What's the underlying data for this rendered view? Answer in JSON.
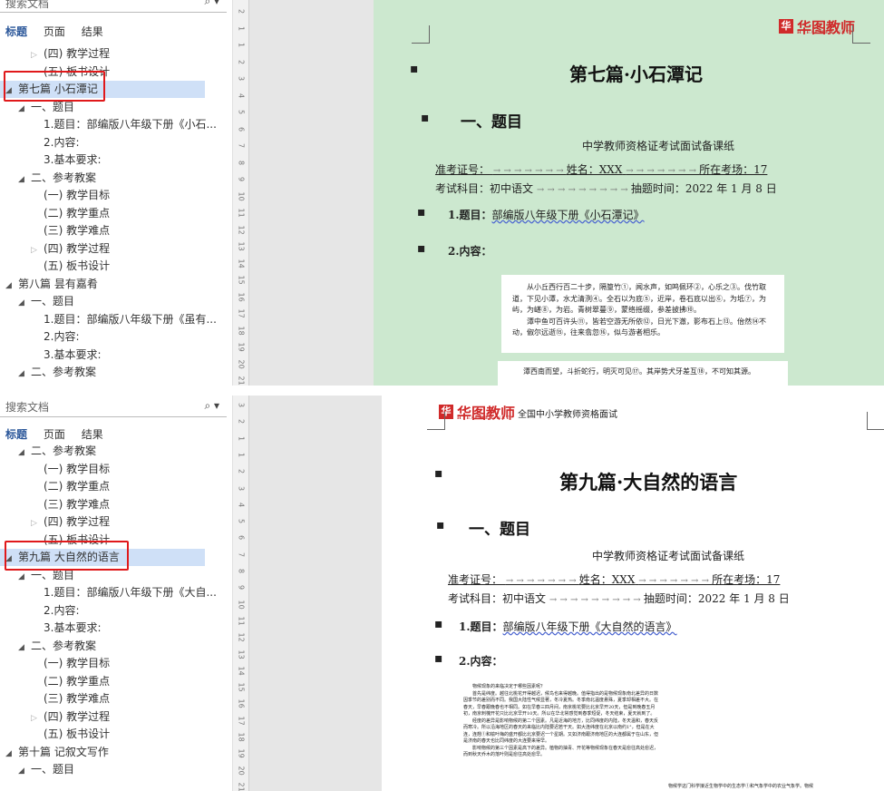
{
  "panel1": {
    "search_placeholder": "搜索文档",
    "tabs": [
      "标题",
      "页面",
      "结果"
    ],
    "tree": [
      {
        "arrow": "▷",
        "label": "(四) 教学过程"
      },
      {
        "arrow": "",
        "label": "(五) 板书设计"
      },
      {
        "arrow": "◢",
        "label": "第七篇 小石潭记"
      },
      {
        "arrow": "◢",
        "label": "一、题目"
      },
      {
        "arrow": "",
        "label": "1.题目：部编版八年级下册《小石..."
      },
      {
        "arrow": "",
        "label": "2.内容:"
      },
      {
        "arrow": "",
        "label": "3.基本要求:"
      },
      {
        "arrow": "◢",
        "label": "二、参考教案"
      },
      {
        "arrow": "",
        "label": "(一) 教学目标"
      },
      {
        "arrow": "",
        "label": "(二) 教学重点"
      },
      {
        "arrow": "",
        "label": "(三) 教学难点"
      },
      {
        "arrow": "▷",
        "label": "(四) 教学过程"
      },
      {
        "arrow": "",
        "label": "(五) 板书设计"
      },
      {
        "arrow": "◢",
        "label": "第八篇 昙有嘉肴"
      },
      {
        "arrow": "◢",
        "label": "一、题目"
      },
      {
        "arrow": "",
        "label": "1.题目：部编版八年级下册《虽有..."
      },
      {
        "arrow": "",
        "label": "2.内容:"
      },
      {
        "arrow": "",
        "label": "3.基本要求:"
      },
      {
        "arrow": "◢",
        "label": "二、参考教案"
      }
    ],
    "ruler": [
      "2",
      "1",
      "1",
      "2",
      "3",
      "4",
      "5",
      "6",
      "7",
      "8",
      "9",
      "10",
      "11",
      "12",
      "13",
      "14",
      "15",
      "16",
      "17",
      "18",
      "19",
      "20",
      "21"
    ],
    "logo_text": "华图教师",
    "logo_sub": "HTEACHER.NET",
    "doc": {
      "title": "第七篇·小石潭记",
      "h1": "一、题目",
      "subtitle": "中学教师资格证考试面试备课纸",
      "exam_no_label": "准考证号：",
      "name_label": "姓名：XXX",
      "room_label": "所在考场：17",
      "subject_label": "考试科目：初中语文",
      "draw_time": "抽题时间：2022 年 1 月 8 日",
      "q1_label": "1.题目：",
      "q1_text": "部编版八年级下册《小石潭记》",
      "q2_label": "2.内容：",
      "passage": [
        "从小丘西行百二十步，隔篁竹①，闻水声，如鸣佩环②，心乐之③。伐竹取道，下见小潭，水尤清洌④。全石以为底⑤，近岸，卷石底以出⑥，为坻⑦，为屿，为嵁⑧，为岩。青树翠蔓⑨，蒙络摇缀，参差披拂⑩。",
        "潭中鱼可百许头⑪，皆若空游无所依⑫，日光下澈，影布石上⑬。佁然⑭不动，俶尔远逝⑮，往来翕忽⑯，似与游者相乐。"
      ],
      "passage2": "潭西南而望，斗折蛇行，明灭可见⑰。其岸势犬牙差互⑱，不可知其源。"
    }
  },
  "panel2": {
    "search_placeholder": "搜索文档",
    "tabs": [
      "标题",
      "页面",
      "结果"
    ],
    "tree": [
      {
        "arrow": "◢",
        "label": "二、参考教案"
      },
      {
        "arrow": "",
        "label": "(一) 教学目标"
      },
      {
        "arrow": "",
        "label": "(二) 教学重点"
      },
      {
        "arrow": "",
        "label": "(三) 教学难点"
      },
      {
        "arrow": "▷",
        "label": "(四) 教学过程"
      },
      {
        "arrow": "",
        "label": "(五) 板书设计"
      },
      {
        "arrow": "◢",
        "label": "第九篇 大自然的语言"
      },
      {
        "arrow": "◢",
        "label": "一、题目"
      },
      {
        "arrow": "",
        "label": "1.题目：部编版八年级下册《大自..."
      },
      {
        "arrow": "",
        "label": "2.内容:"
      },
      {
        "arrow": "",
        "label": "3.基本要求:"
      },
      {
        "arrow": "◢",
        "label": "二、参考教案"
      },
      {
        "arrow": "",
        "label": "(一) 教学目标"
      },
      {
        "arrow": "",
        "label": "(二) 教学重点"
      },
      {
        "arrow": "",
        "label": "(三) 教学难点"
      },
      {
        "arrow": "▷",
        "label": "(四) 教学过程"
      },
      {
        "arrow": "",
        "label": "(五) 板书设计"
      },
      {
        "arrow": "◢",
        "label": "第十篇 记叙文写作"
      },
      {
        "arrow": "◢",
        "label": "一、题目"
      }
    ],
    "ruler": [
      "3",
      "2",
      "1",
      "1",
      "2",
      "3",
      "4",
      "5",
      "6",
      "7",
      "8",
      "9",
      "10",
      "11",
      "12",
      "13",
      "14",
      "15",
      "16",
      "17",
      "18",
      "19",
      "20",
      "21"
    ],
    "logo_text": "华图教师",
    "logo_sub": "HTEACHER.NET",
    "header_text": "全国中小学教师资格面试",
    "doc": {
      "title": "第九篇·大自然的语言",
      "h1": "一、题目",
      "subtitle": "中学教师资格证考试面试备课纸",
      "exam_no_label": "准考证号：",
      "name_label": "姓名：XXX",
      "room_label": "所在考场：17",
      "subject_label": "考试科目：初中语文",
      "draw_time": "抽题时间：2022 年 1 月 8 日",
      "q1_label": "1.题目：",
      "q1_text": "部编版八年级下册《大自然的语言》",
      "q2_label": "2.内容：",
      "passage": [
        "物候现象的来临决定于哪些因素呢？",
        "首先是纬度。越往北桃花开得越迟，候鸟也来得越晚。值得指出的是物候现象南北差异的日数因季节的差别而不同。我国大陆性气候显著，冬冷夏热。冬季南北温度悬殊，夏季却相差不大。在春天，早春跟晚春也不相同。如在早春三四月间，南京桃花要比北京早开20天，但是到晚春五月初，南京刺槐开花只比北京早开10天。所以在华北常感觉到春季短促，冬天结束，夏天就到了。",
        "经度的差异是影响物候的第二个因素。凡是近海的地方，比同纬度的内陆，冬天温和，春天反而寒冷。所以沿海地区的春天的来临比内陆要迟若干天。如大连纬度在北京以南约1°，但是在大连，连翘①和榆叶梅的盛开都比北京要迟一个星期。又如济南跟济南地区的大连都属于在山东，但是济南的春天也比同纬度的大连要来得早。",
        "影响物候的第三个因素是高下的差异。植物的抽青、开花等物候现象在春天是愈往高处愈迟，而到秋天乔木的落叶则是愈往高处愈早。"
      ],
      "side_text": "物候学这门科学接近生物学中的生态学①和气象学中的农业气象学。物候"
    }
  }
}
